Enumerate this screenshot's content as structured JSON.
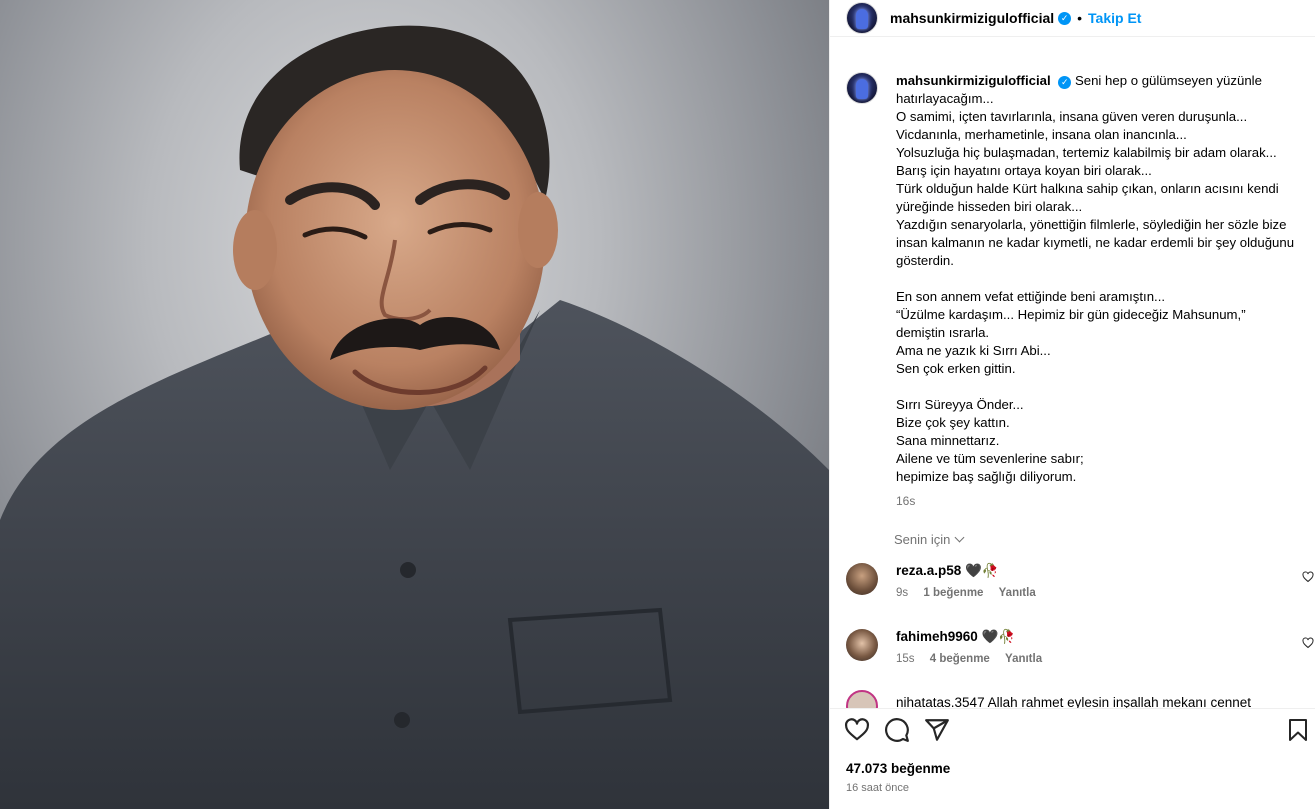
{
  "post": {
    "username": "mahsunkirmizigulofficial",
    "verified_mark": "✓",
    "separator": "•",
    "follow_label": "Takip Et"
  },
  "caption": {
    "username": "mahsunkirmizigulofficial",
    "text": "Seni hep o gülümseyen yüzünle hatırlayacağım...\nO samimi, içten tavırlarınla, insana güven veren duruşunla...\nVicdanınla, merhametinle, insana olan inancınla...\nYolsuzluğa hiç bulaşmadan, tertemiz kalabilmiş bir adam olarak...\nBarış için hayatını ortaya koyan biri olarak...\nTürk olduğun halde Kürt halkına sahip çıkan, onların acısını kendi yüreğinde hisseden biri olarak...\nYazdığın senaryolarla, yönettiğin filmlerle, söylediğin her sözle bize insan kalmanın ne kadar kıymetli, ne kadar erdemli bir şey olduğunu gösterdin.\n\nEn son annem vefat ettiğinde beni aramıştın...\n“Üzülme kardaşım... Hepimiz bir gün gideceğiz Mahsunum,”\ndemiştin ısrarla.\nAma ne yazık ki Sırrı Abi...\nSen çok erken gittin.\n\nSırrı Süreyya Önder...\nBize çok şey kattın.\nSana minnettarız.\nAilene ve tüm sevenlerine sabır;\nhepimize baş sağlığı diliyorum.",
    "time": "16s"
  },
  "filter": {
    "label": "Senin için"
  },
  "comments": [
    {
      "username": "reza.a.p58",
      "emoji": "🖤🥀",
      "time": "9s",
      "likes": "1 beğenme",
      "reply": "Yanıtla"
    },
    {
      "username": "fahimeh9960",
      "emoji": "🖤🥀",
      "time": "15s",
      "likes": "4 beğenme",
      "reply": "Yanıtla"
    },
    {
      "text": "nihatatas.3547 Allah rahmet eylesin inşallah mekanı cennet"
    }
  ],
  "footer": {
    "likes": "47.073 beğenme",
    "time_ago": "16 saat önce"
  },
  "icons": [
    "heart-icon",
    "comment-icon",
    "share-icon",
    "bookmark-icon",
    "verified-icon",
    "chevron-down-icon"
  ]
}
